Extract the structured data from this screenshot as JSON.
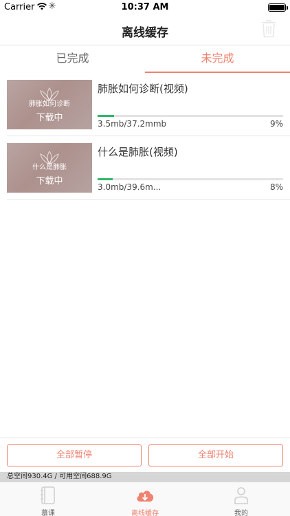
{
  "status_bar": {
    "carrier": "Carrier",
    "time": "10:37 AM"
  },
  "nav": {
    "title": "离线缓存",
    "trash_icon": "trash-icon"
  },
  "tabs": [
    {
      "label": "已完成",
      "active": false
    },
    {
      "label": "未完成",
      "active": true
    }
  ],
  "downloads": [
    {
      "title": "肺胀如何诊断(视频)",
      "thumb_caption": "肺胀如何诊断",
      "status": "下载中",
      "size": "3.5mb/37.2mmb",
      "percent": "9%",
      "progress": 0.09
    },
    {
      "title": "什么是肺胀(视频)",
      "thumb_caption": "什么是肺胀",
      "status": "下载中",
      "size": "3.0mb/39.6m...",
      "percent": "8%",
      "progress": 0.08
    }
  ],
  "actions": {
    "pause_all": "全部暂停",
    "start_all": "全部开始"
  },
  "storage": "总空间930.4G / 可用空间688.9G",
  "tabbar": [
    {
      "label": "慕课",
      "icon": "book-icon"
    },
    {
      "label": "离线缓存",
      "icon": "download-icon",
      "active": true
    },
    {
      "label": "我的",
      "icon": "person-icon"
    }
  ],
  "colors": {
    "accent": "#ef8270",
    "progress": "#2eb86a"
  }
}
